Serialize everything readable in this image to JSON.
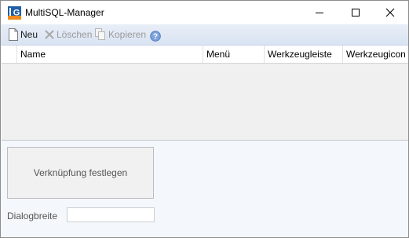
{
  "window": {
    "title": "MultiSQL-Manager",
    "logo_text": "G",
    "controls": {
      "minimize": "minimize-icon",
      "maximize": "maximize-icon",
      "close": "close-icon"
    }
  },
  "toolbar": {
    "new": {
      "label": "Neu",
      "icon": "new-document-icon",
      "enabled": true
    },
    "delete": {
      "label": "Löschen",
      "icon": "delete-x-icon",
      "enabled": false
    },
    "copy": {
      "label": "Kopieren",
      "icon": "copy-icon",
      "enabled": false
    },
    "help": {
      "icon": "help-icon"
    }
  },
  "grid": {
    "columns": [
      "",
      "Name",
      "Menü",
      "Werkzeugleiste",
      "Werkzeugicon"
    ],
    "rows": []
  },
  "panel": {
    "link_button_label": "Verknüpfung festlegen",
    "dialog_width_label": "Dialogbreite",
    "dialog_width_value": ""
  },
  "colors": {
    "toolbar_bg": "#dde6f3",
    "panel_bg": "#f4f7fb",
    "grid_bg": "#f0f0f0",
    "logo_blue": "#1f5fa8",
    "logo_orange": "#f08a1c",
    "help_blue": "#5b8bd0"
  }
}
